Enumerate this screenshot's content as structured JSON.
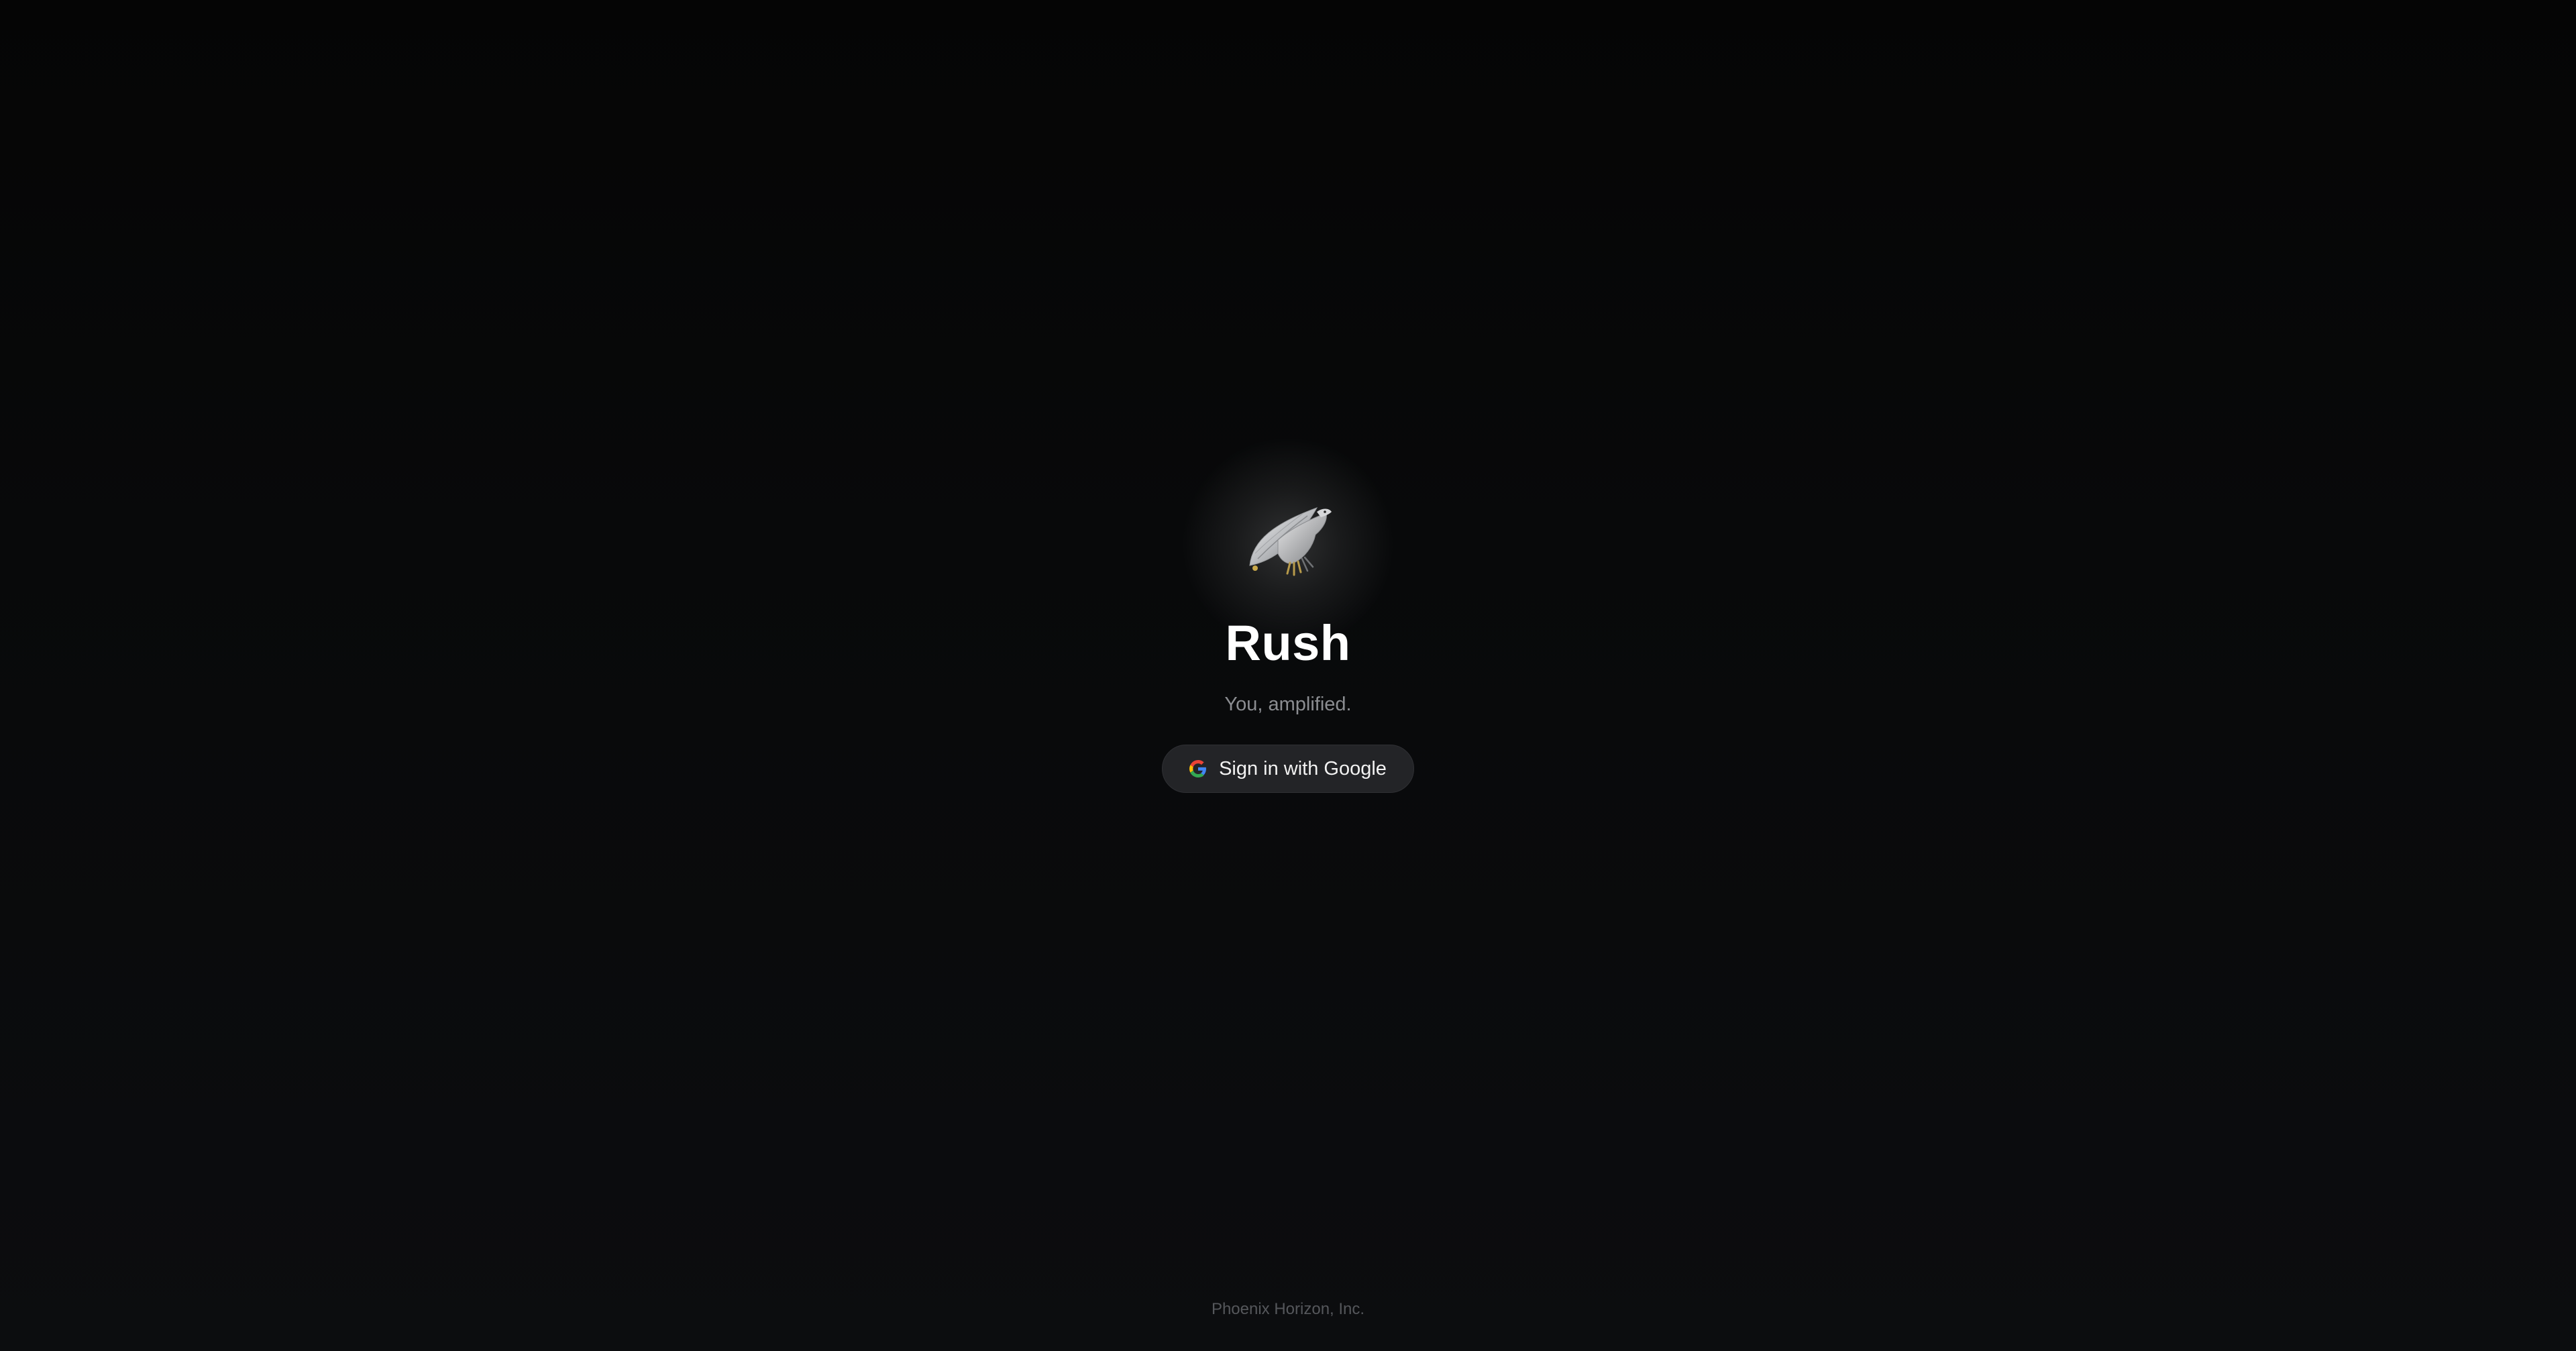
{
  "app": {
    "title": "Rush",
    "tagline": "You, amplified."
  },
  "logo": {
    "icon": "falcon-icon"
  },
  "signin": {
    "label": "Sign in with Google",
    "icon": "google-icon"
  },
  "footer": {
    "company": "Phoenix Horizon, Inc."
  },
  "colors": {
    "background": "#050505",
    "button_bg": "#232427",
    "title": "#ffffff",
    "tagline": "#8b8d91",
    "footer": "#55575b"
  }
}
